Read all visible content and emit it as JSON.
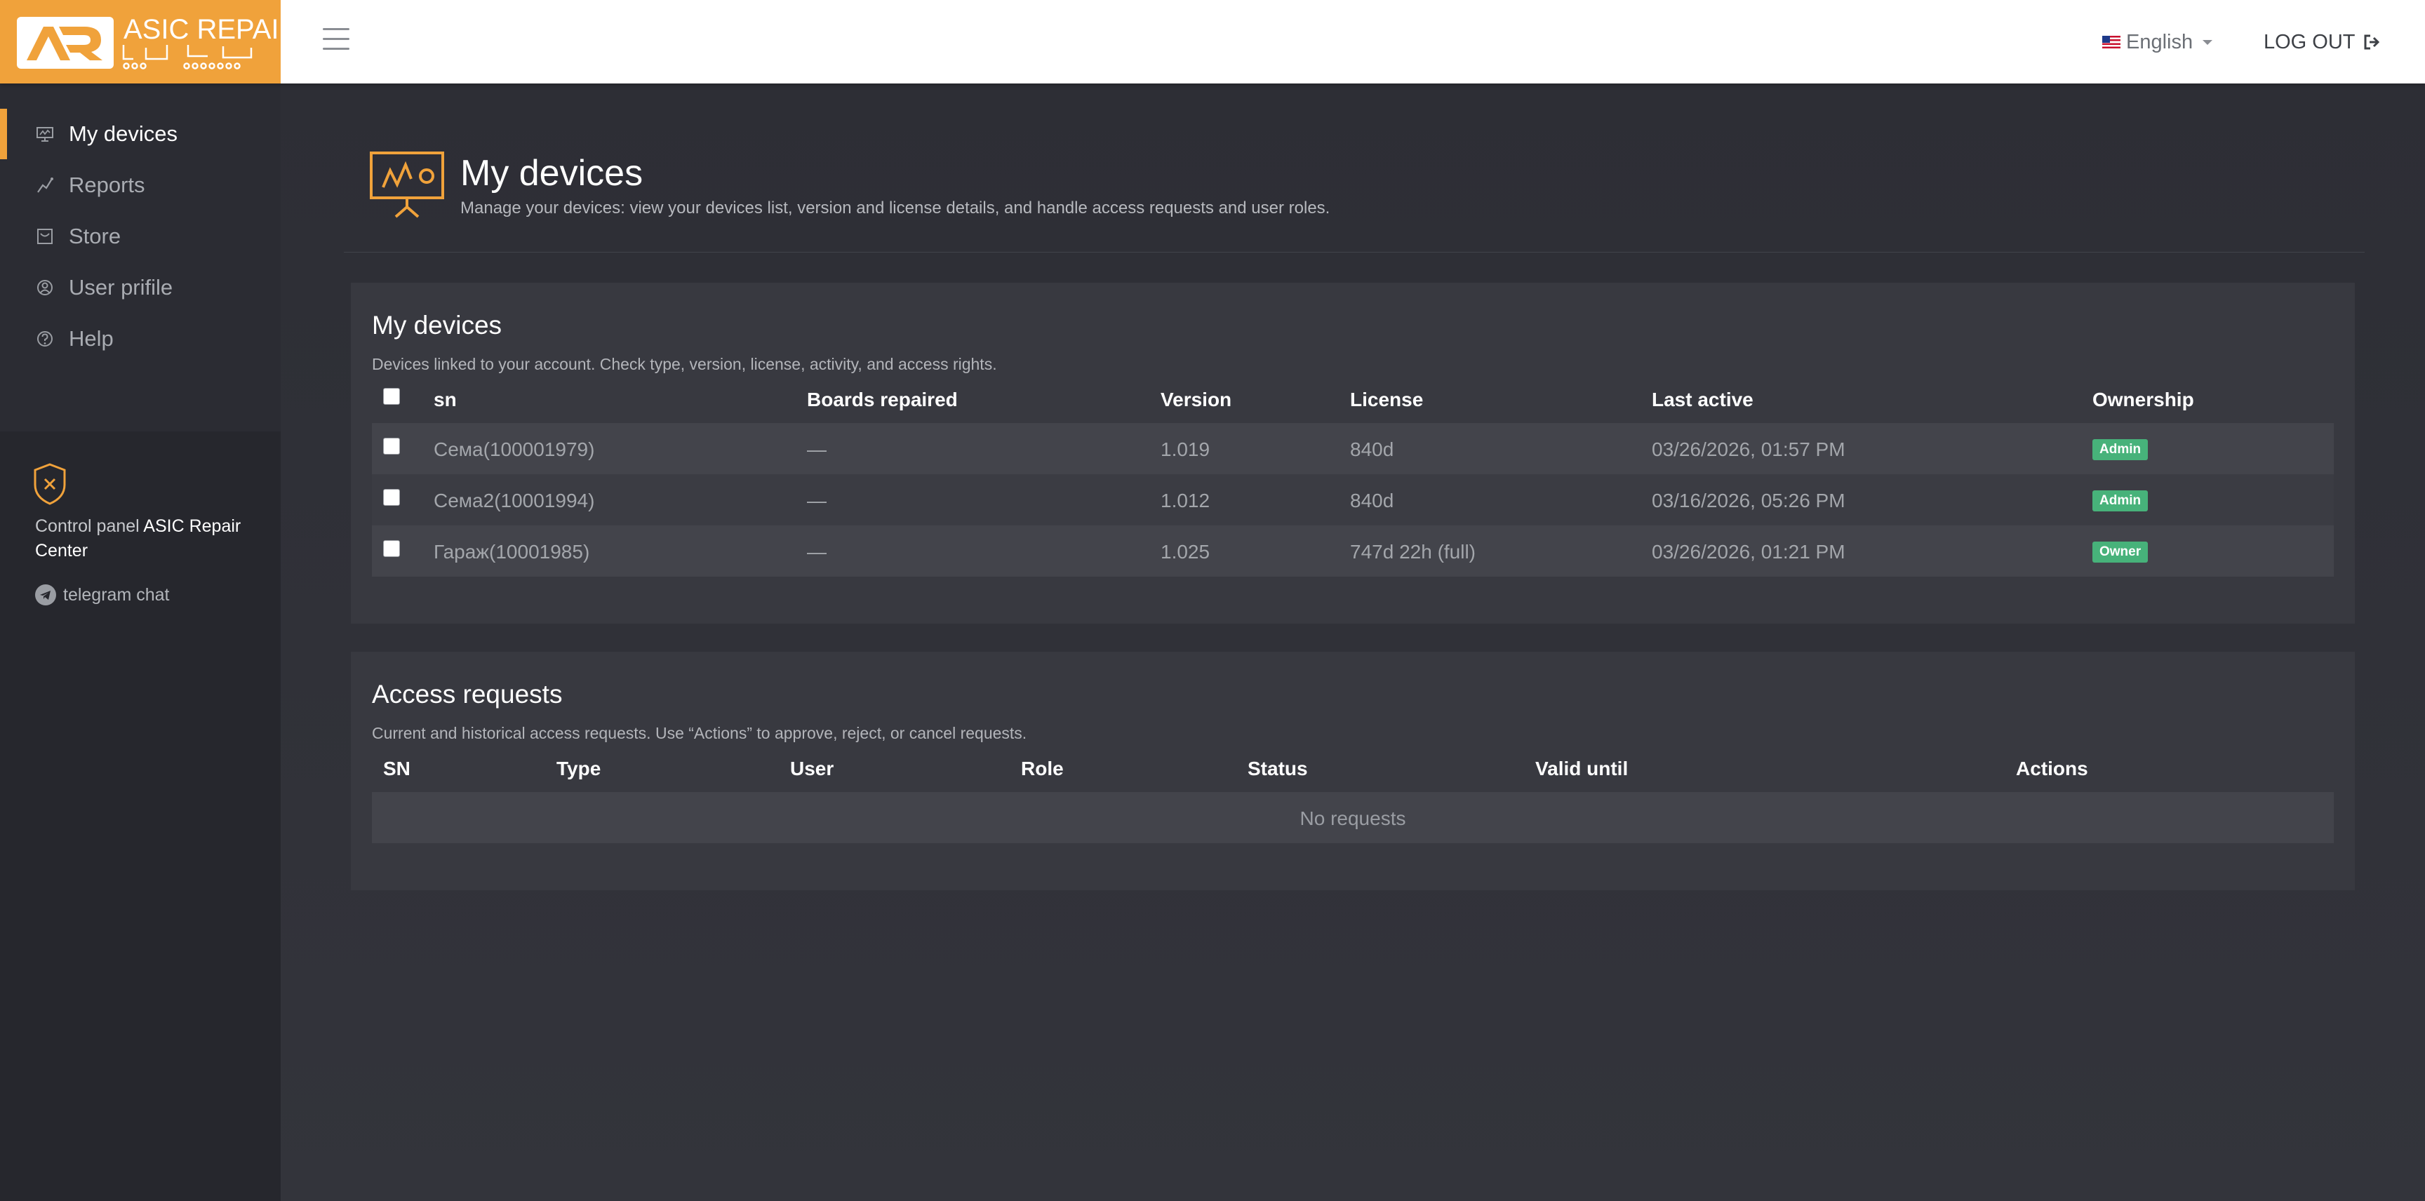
{
  "brand": {
    "initials": "AR",
    "name": "ASIC REPAIR"
  },
  "header": {
    "language": "English",
    "logout": "LOG OUT"
  },
  "sidebar": {
    "items": [
      {
        "label": "My devices",
        "icon": "monitor-chart-icon",
        "active": true
      },
      {
        "label": "Reports",
        "icon": "line-chart-icon"
      },
      {
        "label": "Store",
        "icon": "store-icon"
      },
      {
        "label": "User prifile",
        "icon": "user-circle-icon"
      },
      {
        "label": "Help",
        "icon": "help-circle-icon"
      }
    ],
    "control_panel_prefix": "Control panel",
    "control_panel_name": "ASIC Repair Center",
    "telegram": "telegram chat"
  },
  "page": {
    "title": "My devices",
    "description": "Manage your devices: view your devices list, version and license details, and handle access requests and user roles."
  },
  "devices": {
    "title": "My devices",
    "description": "Devices linked to your account. Check type, version, license, activity, and access rights.",
    "columns": [
      "sn",
      "Boards repaired",
      "Version",
      "License",
      "Last active",
      "Ownership"
    ],
    "rows": [
      {
        "sn": "Сема(100001979)",
        "boards": "—",
        "version": "1.019",
        "license": "840d",
        "last_active": "03/26/2026, 01:57 PM",
        "ownership": "Admin"
      },
      {
        "sn": "Сема2(10001994)",
        "boards": "—",
        "version": "1.012",
        "license": "840d",
        "last_active": "03/16/2026, 05:26 PM",
        "ownership": "Admin"
      },
      {
        "sn": "Гараж(10001985)",
        "boards": "—",
        "version": "1.025",
        "license": "747d 22h (full)",
        "last_active": "03/26/2026, 01:21 PM",
        "ownership": "Owner"
      }
    ]
  },
  "requests": {
    "title": "Access requests",
    "description": "Current and historical access requests. Use “Actions” to approve, reject, or cancel requests.",
    "columns": [
      "SN",
      "Type",
      "User",
      "Role",
      "Status",
      "Valid until",
      "Actions"
    ],
    "empty": "No requests"
  },
  "colors": {
    "accent": "#f0a23b",
    "badge": "#47b27a",
    "background": "#2f3037"
  }
}
